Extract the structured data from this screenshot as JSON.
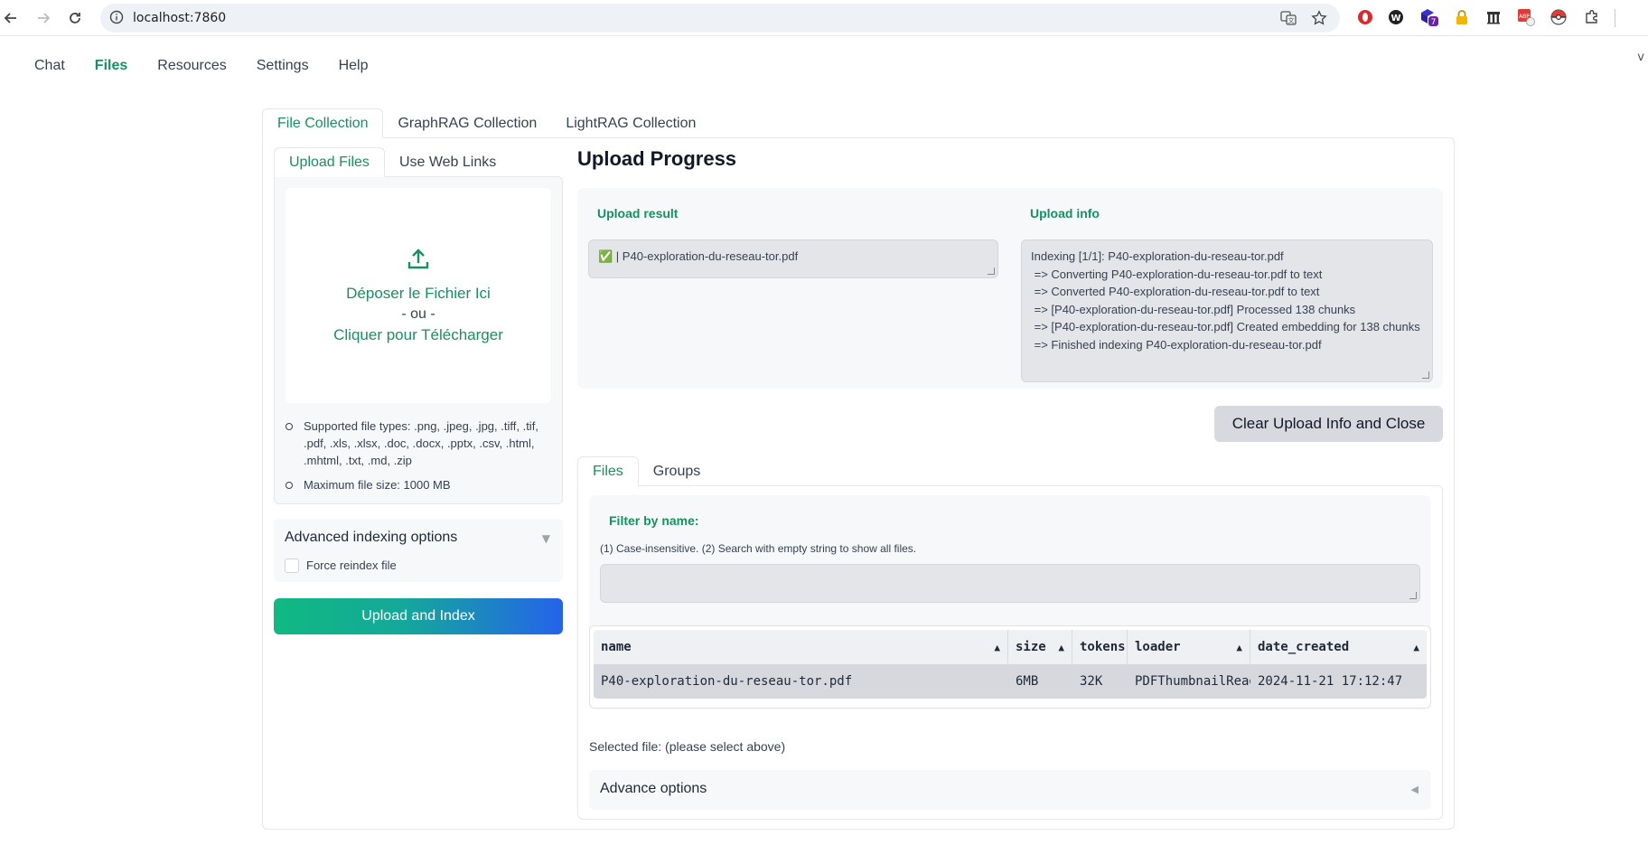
{
  "browser": {
    "url": "localhost:7860",
    "extensions": [
      "opera-icon",
      "wordpress-icon",
      "puzzle-badge-icon",
      "lock-icon",
      "archive-icon",
      "abp-icon",
      "pokeball-icon",
      "extensions-icon"
    ],
    "badge_count": "7",
    "corner_text": "v"
  },
  "nav": {
    "items": [
      "Chat",
      "Files",
      "Resources",
      "Settings",
      "Help"
    ],
    "active": "Files"
  },
  "collection_tabs": [
    "File Collection",
    "GraphRAG Collection",
    "LightRAG Collection"
  ],
  "upload_tabs": [
    "Upload Files",
    "Use Web Links"
  ],
  "dropzone": {
    "line1": "Déposer le Fichier Ici",
    "line2": "- ou -",
    "line3": "Cliquer pour Télécharger"
  },
  "file_notes": {
    "types": "Supported file types: .png, .jpeg, .jpg, .tiff, .tif, .pdf, .xls, .xlsx, .doc, .docx, .pptx, .csv, .html, .mhtml, .txt, .md, .zip",
    "max_size": "Maximum file size: 1000 MB"
  },
  "advanced_indexing": {
    "title": "Advanced indexing options",
    "force_reindex_label": "Force reindex file"
  },
  "upload_button": "Upload and Index",
  "progress": {
    "heading": "Upload Progress",
    "result_label": "Upload result",
    "result_text": "✅ | P40-exploration-du-reseau-tor.pdf",
    "info_label": "Upload info",
    "info_lines": [
      "Indexing [1/1]: P40-exploration-du-reseau-tor.pdf",
      " => Converting P40-exploration-du-reseau-tor.pdf to text",
      " => Converted P40-exploration-du-reseau-tor.pdf to text",
      " => [P40-exploration-du-reseau-tor.pdf] Processed 138 chunks",
      " => [P40-exploration-du-reseau-tor.pdf] Created embedding for 138 chunks",
      " => Finished indexing P40-exploration-du-reseau-tor.pdf"
    ],
    "clear_button": "Clear Upload Info and Close"
  },
  "file_tabs": [
    "Files",
    "Groups"
  ],
  "filter": {
    "label": "Filter by name:",
    "hint": "(1) Case-insensitive. (2) Search with empty string to show all files.",
    "value": ""
  },
  "table": {
    "headers": [
      "name",
      "size",
      "tokens",
      "loader",
      "date_created"
    ],
    "rows": [
      [
        "P40-exploration-du-reseau-tor.pdf",
        "6MB",
        "32K",
        "PDFThumbnailReader",
        "2024-11-21 17:12:47"
      ]
    ]
  },
  "selected_file": "Selected file: (please select above)",
  "advance_options": "Advance options"
}
